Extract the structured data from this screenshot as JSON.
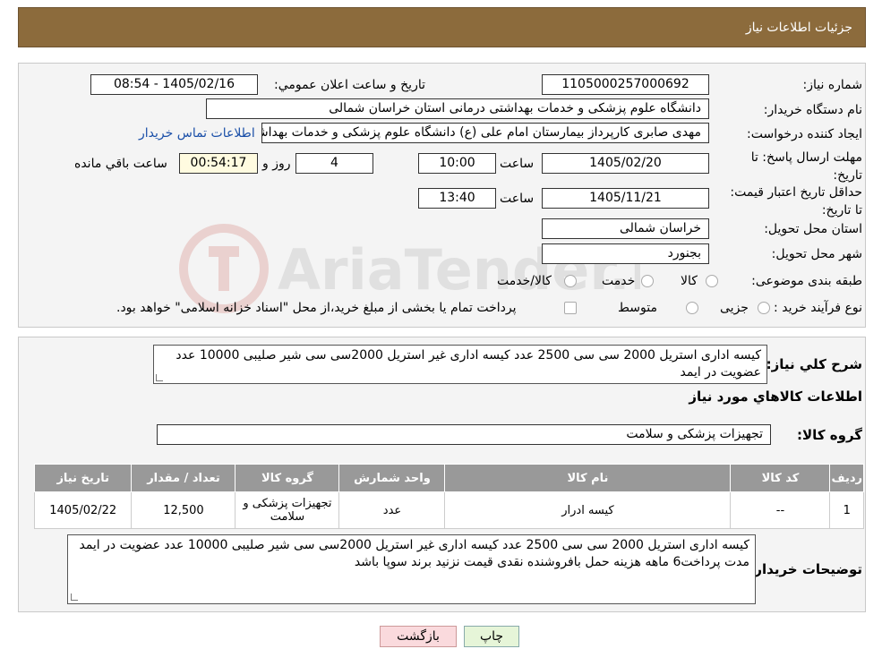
{
  "header": {
    "title": "جزئیات اطلاعات نیاز"
  },
  "labels": {
    "need_number": "شماره نیاز:",
    "announce_datetime": "تاريخ و ساعت اعلان عمومي:",
    "buyer_org": "نام دستگاه خريدار:",
    "requester": "ايجاد کننده درخواست:",
    "reply_deadline": "مهلت ارسال پاسخ: تا تاریخ:",
    "hour": "ساعت",
    "day_and": "روز و",
    "remaining": "ساعت باقي مانده",
    "price_validity": "حداقل تاريخ اعتبار قيمت: تا تاریخ:",
    "delivery_province": "استان محل تحويل:",
    "delivery_city": "شهر محل تحويل:",
    "category": "طبقه بندی موضوعی:",
    "process_type": "نوع فرآيند خريد :",
    "general_desc": "شرح کلي نياز:",
    "goods_info": "اطلاعات کالاهاي مورد نياز",
    "goods_group": "گروه کالا:",
    "buyer_notes": "توضيحات خريدار:"
  },
  "values": {
    "need_number": "1105000257000692",
    "announce_datetime": "1405/02/16 - 08:54",
    "buyer_org": "دانشگاه علوم پزشکی و خدمات بهداشتی درمانی استان خراسان شمالی",
    "requester": "مهدی صابری کارپرداز بیمارستان امام علی (ع) دانشگاه علوم پزشکی و خدمات بهداشتی",
    "contact_link": "اطلاعات تماس خریدار",
    "reply_date": "1405/02/20",
    "reply_hour": "10:00",
    "days": "4",
    "remaining_time": "00:54:17",
    "validity_date": "1405/11/21",
    "validity_hour": "13:40",
    "province": "خراسان شمالی",
    "city": "بجنورد",
    "goods_group": "تجهیزات پزشکی و سلامت",
    "general_desc": "کیسه اداری استریل 2000 سی سی 2500 عدد کیسه اداری غیر استریل 2000سی سی شیر صلیبی 10000 عدد عضویت در ایمد",
    "buyer_notes": "کیسه اداری استریل 2000 سی سی 2500 عدد کیسه اداری غیر استریل 2000سی سی شیر صلیبی 10000 عدد عضویت در ایمد مدت پرداخت6 ماهه هزینه حمل بافروشنده نقدی قیمت نزنید برند سوپا باشد"
  },
  "category_options": [
    "کالا",
    "خدمت",
    "کالا/خدمت"
  ],
  "process_options": [
    "جزیی",
    "متوسط"
  ],
  "process_note": "پرداخت تمام یا بخشی از مبلغ خرید،از محل \"اسناد خزانه اسلامی\" خواهد بود.",
  "table": {
    "headers": [
      "ردیف",
      "کد کالا",
      "نام کالا",
      "واحد شمارش",
      "گروه کالا",
      "تعداد / مقدار",
      "تاریخ نیاز"
    ],
    "rows": [
      [
        "1",
        "--",
        "کیسه ادرار",
        "عدد",
        "تجهیزات پزشکی و سلامت",
        "12,500",
        "1405/02/22"
      ]
    ]
  },
  "buttons": {
    "print": "چاپ",
    "back": "بازگشت"
  },
  "watermark": {
    "text": "AriaTender.neT"
  },
  "colors": {
    "header_bg": "#8c6b3c",
    "table_header": "#999999",
    "back_button": "#fadadd",
    "print_button": "#e6f5d8",
    "link": "#1a4fa8"
  }
}
